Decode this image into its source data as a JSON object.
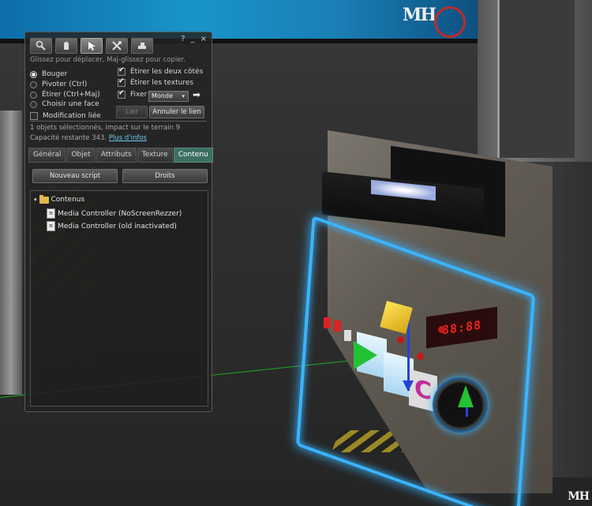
{
  "scene": {
    "banner_logo": "MH",
    "led_display": "88:88",
    "panel_letter": "C",
    "watermark": "MH"
  },
  "floater": {
    "tool_tabs": [
      "focus-icon",
      "move-icon",
      "edit-icon",
      "create-icon",
      "land-icon"
    ],
    "window_controls": {
      "help": "?",
      "minimize": "_",
      "close": "×"
    },
    "hint": "Glissez pour déplacer, Maj-glissez pour copier.",
    "modes": [
      {
        "label": "Bouger",
        "selected": true
      },
      {
        "label": "Pivoter (Ctrl)",
        "selected": false
      },
      {
        "label": "Étirer (Ctrl+Maj)",
        "selected": false
      },
      {
        "label": "Choisir une face",
        "selected": false
      }
    ],
    "linked_edit": {
      "label": "Modification liée",
      "checked": false
    },
    "options": [
      {
        "label": "Étirer les deux côtés",
        "checked": true
      },
      {
        "label": "Étirer les textures",
        "checked": true
      },
      {
        "label": "Fixer",
        "checked": true
      }
    ],
    "grid_dropdown": {
      "value": "Monde",
      "arrow": "▾"
    },
    "next_arrow": "➡",
    "link_button": "Lier",
    "unlink_button": "Annuler le lien",
    "info": {
      "selection": "1 objets sélectionnés, impact sur le terrain 9",
      "capacity": "Capacité restante 343.",
      "more_info": "Plus d'infos"
    },
    "tabs": [
      {
        "label": "Général",
        "active": false
      },
      {
        "label": "Objet",
        "active": false
      },
      {
        "label": "Attributs",
        "active": false
      },
      {
        "label": "Texture",
        "active": false
      },
      {
        "label": "Contenu",
        "active": true
      }
    ],
    "new_script_button": "Nouveau script",
    "permissions_button": "Droits",
    "inventory": {
      "folder_arrow": "▾",
      "folder": "Contenus",
      "items": [
        "Media Controller (NoScreenRezzer)",
        "Media Controller (old inactivated)"
      ],
      "item_icon": "script-icon"
    }
  }
}
